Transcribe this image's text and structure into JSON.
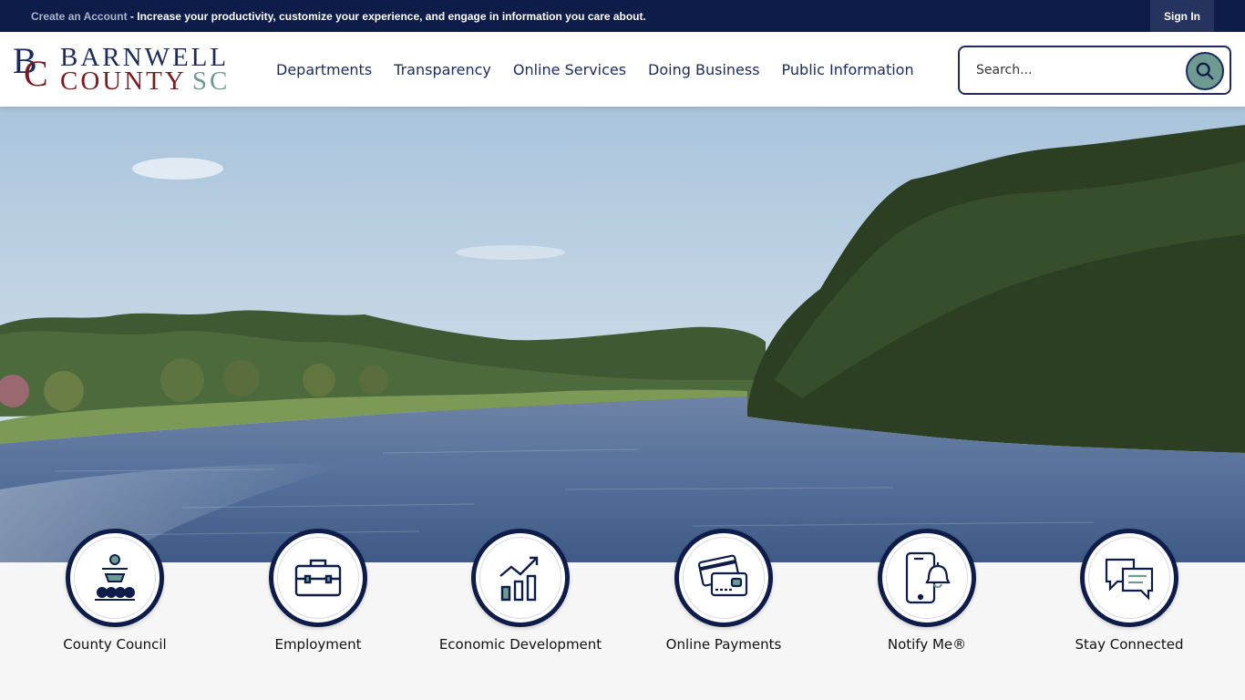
{
  "topbar": {
    "create_account_link": "Create an Account",
    "message": " - Increase your productivity, customize your experience, and engage in information you care about.",
    "sign_in_label": "Sign In"
  },
  "logo": {
    "monogram_b": "B",
    "monogram_c": "C",
    "line1": "BARNWELL",
    "line2": "COUNTY",
    "line2_suffix": "SC"
  },
  "nav": {
    "items": [
      "Departments",
      "Transparency",
      "Online Services",
      "Doing Business",
      "Public Information"
    ]
  },
  "search": {
    "placeholder": "Search..."
  },
  "quick_links": [
    {
      "label": "County Council",
      "icon": "podium-audience-icon"
    },
    {
      "label": "Employment",
      "icon": "briefcase-icon"
    },
    {
      "label": "Economic Development",
      "icon": "growth-chart-icon"
    },
    {
      "label": "Online Payments",
      "icon": "credit-card-icon"
    },
    {
      "label": "Notify Me®",
      "icon": "phone-bell-icon"
    },
    {
      "label": "Stay Connected",
      "icon": "chat-bubbles-icon"
    }
  ],
  "colors": {
    "navy": "#0e1c4a",
    "brand_blue": "#1c2b5e",
    "brand_red": "#7a1b22",
    "accent_teal": "#6f9a92"
  }
}
